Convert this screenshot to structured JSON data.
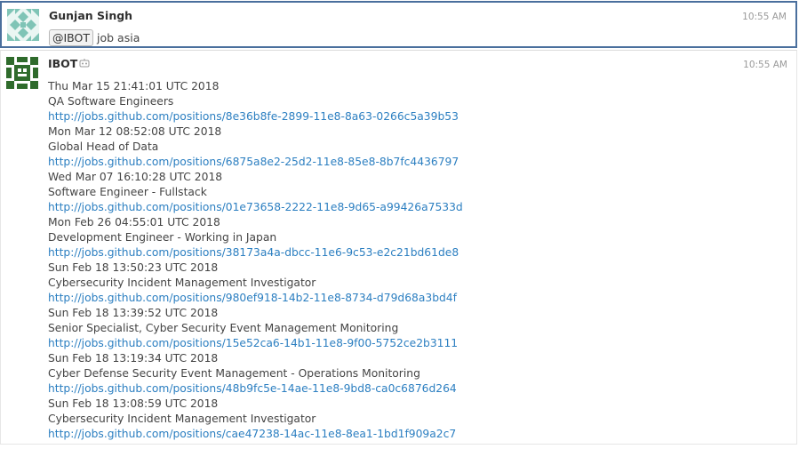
{
  "messages": [
    {
      "author": "Gunjan Singh",
      "time": "10:55 AM",
      "mention": "@IBOT",
      "text": "job asia"
    },
    {
      "author": "IBOT",
      "time": "10:55 AM",
      "lines": [
        "Thu Mar 15 21:41:01 UTC 2018",
        "QA Software Engineers",
        "http://jobs.github.com/positions/8e36b8fe-2899-11e8-8a63-0266c5a39b53",
        "Mon Mar 12 08:52:08 UTC 2018",
        "Global Head of Data",
        "http://jobs.github.com/positions/6875a8e2-25d2-11e8-85e8-8b7fc4436797",
        "Wed Mar 07 16:10:28 UTC 2018",
        "Software Engineer - Fullstack",
        "http://jobs.github.com/positions/01e73658-2222-11e8-9d65-a99426a7533d",
        "Mon Feb 26 04:55:01 UTC 2018",
        "Development Engineer - Working in Japan",
        "http://jobs.github.com/positions/38173a4a-dbcc-11e6-9c53-e2c21bd61de8",
        "Sun Feb 18 13:50:23 UTC 2018",
        "Cybersecurity Incident Management Investigator",
        "http://jobs.github.com/positions/980ef918-14b2-11e8-8734-d79d68a3bd4f",
        "Sun Feb 18 13:39:52 UTC 2018",
        "Senior Specialist, Cyber Security Event Management Monitoring",
        "http://jobs.github.com/positions/15e52ca6-14b1-11e8-9f00-5752ce2b3111",
        "Sun Feb 18 13:19:34 UTC 2018",
        "Cyber Defense Security Event Management - Operations Monitoring",
        "http://jobs.github.com/positions/48b9fc5e-14ae-11e8-9bd8-ca0c6876d264",
        "Sun Feb 18 13:08:59 UTC 2018",
        "Cybersecurity Incident Management Investigator",
        "http://jobs.github.com/positions/cae47238-14ac-11e8-8ea1-1bd1f909a2c7"
      ]
    }
  ]
}
